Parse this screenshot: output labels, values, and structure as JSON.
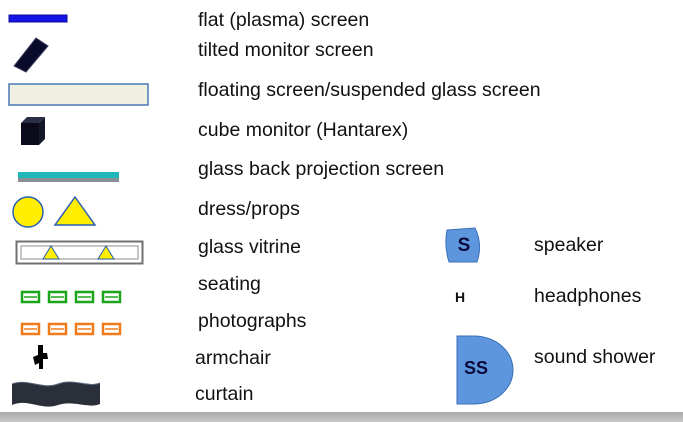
{
  "legend": {
    "flat_screen": "flat (plasma) screen",
    "tilted_monitor": "tilted monitor screen",
    "floating_screen": "floating screen/suspended glass screen",
    "cube_monitor": "cube monitor (Hantarex)",
    "glass_back_projection": "glass back projection screen",
    "dress_props": "dress/props",
    "glass_vitrine": "glass vitrine",
    "seating": "seating",
    "photographs": "photographs",
    "armchair": "armchair",
    "curtain": "curtain"
  },
  "audio_legend": {
    "speaker_symbol": "S",
    "speaker": "speaker",
    "headphones_symbol": "H",
    "headphones": "headphones",
    "sound_shower_symbol": "SS",
    "sound_shower": "sound shower"
  },
  "colors": {
    "plasma_blue": "#1414e6",
    "monitor_black": "#0a0a2a",
    "floating_beige": "#efefe2",
    "floating_border": "#4a78b4",
    "glass_teal": "#1fb7b7",
    "props_yellow": "#ffee00",
    "props_outline": "#2a5fb0",
    "seating_green": "#1aa51a",
    "photo_orange": "#f07a1a",
    "speaker_blue": "#5e96de",
    "curtain_dark": "#2a2f3a"
  }
}
